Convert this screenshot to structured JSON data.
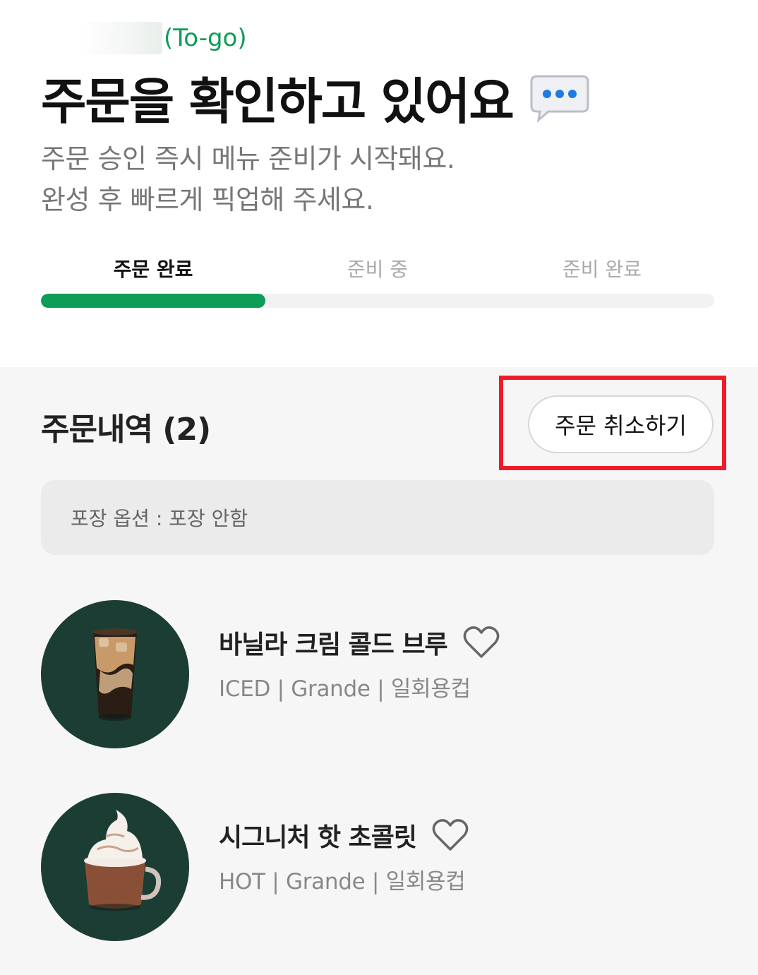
{
  "header": {
    "store_suffix": "(To-go)",
    "headline": "주문을 확인하고 있어요",
    "subtitle_line1": "주문 승인 즉시 메뉴 준비가 시작돼요.",
    "subtitle_line2": "완성 후 빠르게 픽업해 주세요."
  },
  "progress": {
    "steps": [
      "주문 완료",
      "준비 중",
      "준비 완료"
    ],
    "current_step": 1,
    "fill_fraction": 0.333,
    "accent_color": "#0e9d56"
  },
  "order": {
    "title": "주문내역 (2)",
    "cancel_label": "주문 취소하기",
    "highlight_color": "#ee1c2b",
    "packaging_option": "포장 옵션 : 포장 안함",
    "items": [
      {
        "name": "바닐라 크림 콜드 브루",
        "options": "ICED | Grande | 일회용컵",
        "icon": "iced-coffee-image"
      },
      {
        "name": "시그니처 핫 초콜릿",
        "options": "HOT | Grande | 일회용컵",
        "icon": "hot-chocolate-image"
      }
    ]
  }
}
